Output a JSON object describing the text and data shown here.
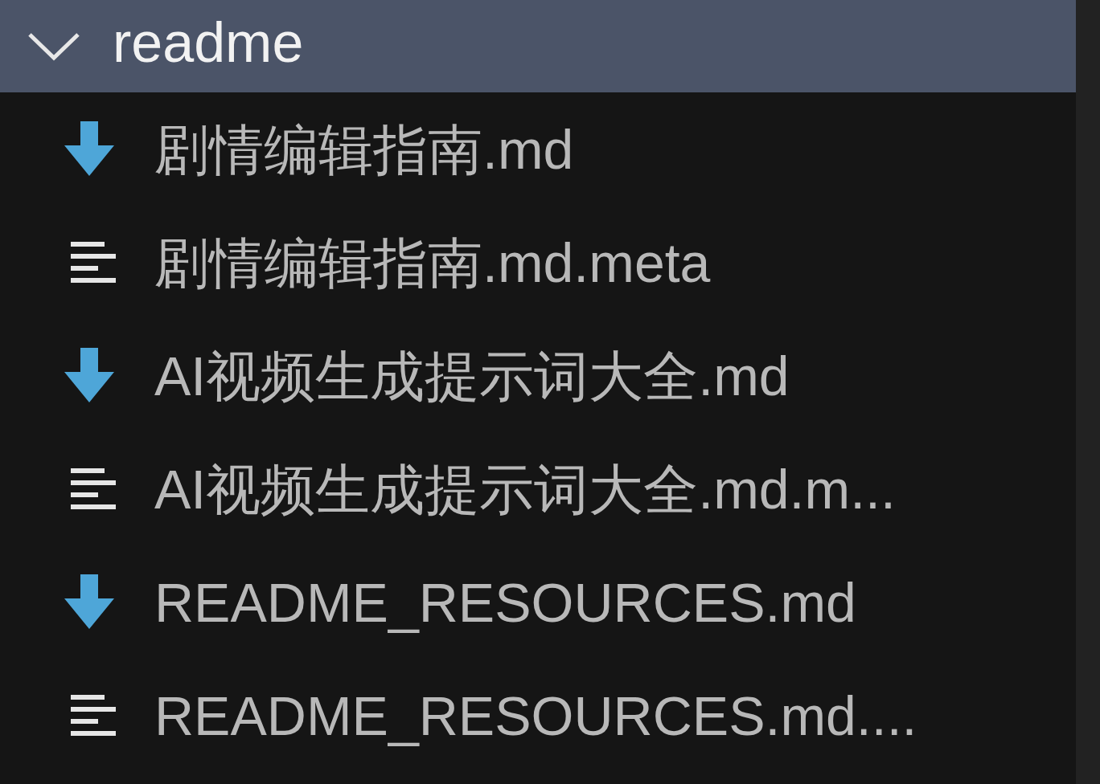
{
  "folder": {
    "name": "readme",
    "expanded": true
  },
  "files": [
    {
      "name": "剧情编辑指南.md",
      "kind": "markdown"
    },
    {
      "name": "剧情编辑指南.md.meta",
      "kind": "meta"
    },
    {
      "name": "AI视频生成提示词大全.md",
      "kind": "markdown"
    },
    {
      "name": "AI视频生成提示词大全.md.m...",
      "kind": "meta"
    },
    {
      "name": "README_RESOURCES.md",
      "kind": "markdown"
    },
    {
      "name": "README_RESOURCES.md....",
      "kind": "meta"
    }
  ]
}
